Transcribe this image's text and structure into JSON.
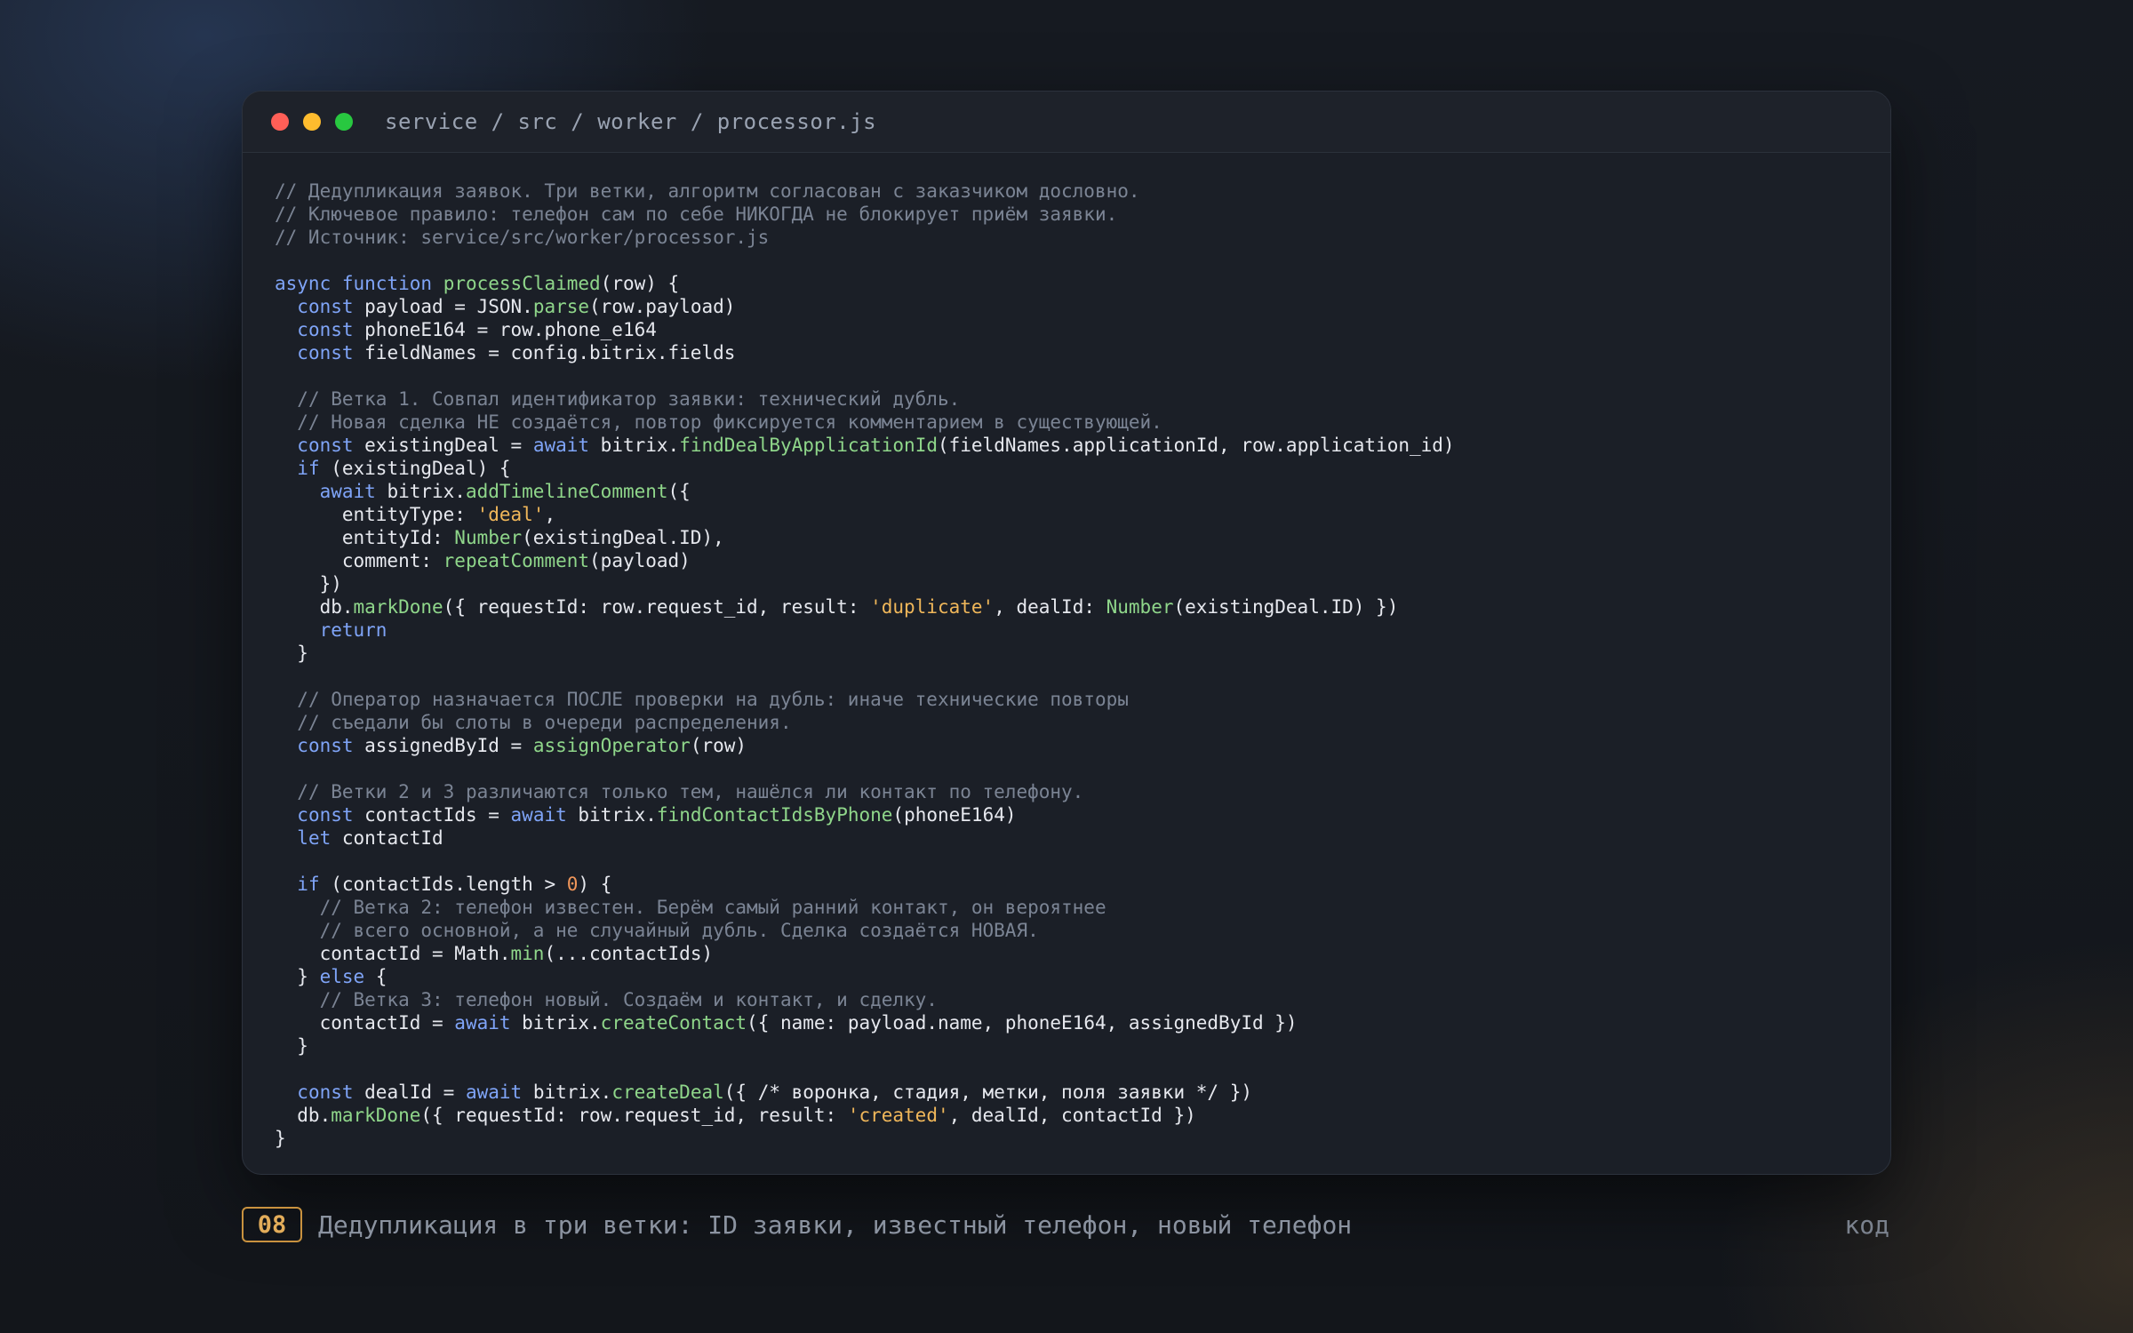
{
  "window": {
    "path": "service / src / worker / processor.js"
  },
  "colors": {
    "comment": "#7b8494",
    "keyword": "#7fa4f7",
    "function": "#8fd68a",
    "string": "#f0b75a",
    "number": "#f0965a",
    "text": "#e6e8ee",
    "badge": "#c9923f"
  },
  "code_lines": [
    [
      {
        "t": "c",
        "v": "// Дедупликация заявок. Три ветки, алгоритм согласован с заказчиком дословно."
      }
    ],
    [
      {
        "t": "c",
        "v": "// Ключевое правило: телефон сам по себе НИКОГДА не блокирует приём заявки."
      }
    ],
    [
      {
        "t": "c",
        "v": "// Источник: service/src/worker/processor.js"
      }
    ],
    [],
    [
      {
        "t": "k",
        "v": "async"
      },
      {
        "t": "p",
        "v": " "
      },
      {
        "t": "k",
        "v": "function"
      },
      {
        "t": "p",
        "v": " "
      },
      {
        "t": "fn",
        "v": "processClaimed"
      },
      {
        "t": "p",
        "v": "(row) {"
      }
    ],
    [
      {
        "t": "p",
        "v": "  "
      },
      {
        "t": "k",
        "v": "const"
      },
      {
        "t": "p",
        "v": " payload = JSON."
      },
      {
        "t": "fn",
        "v": "parse"
      },
      {
        "t": "p",
        "v": "(row.payload)"
      }
    ],
    [
      {
        "t": "p",
        "v": "  "
      },
      {
        "t": "k",
        "v": "const"
      },
      {
        "t": "p",
        "v": " phoneE164 = row.phone_e164"
      }
    ],
    [
      {
        "t": "p",
        "v": "  "
      },
      {
        "t": "k",
        "v": "const"
      },
      {
        "t": "p",
        "v": " fieldNames = config.bitrix.fields"
      }
    ],
    [],
    [
      {
        "t": "p",
        "v": "  "
      },
      {
        "t": "c",
        "v": "// Ветка 1. Совпал идентификатор заявки: технический дубль."
      }
    ],
    [
      {
        "t": "p",
        "v": "  "
      },
      {
        "t": "c",
        "v": "// Новая сделка НЕ создаётся, повтор фиксируется комментарием в существующей."
      }
    ],
    [
      {
        "t": "p",
        "v": "  "
      },
      {
        "t": "k",
        "v": "const"
      },
      {
        "t": "p",
        "v": " existingDeal = "
      },
      {
        "t": "k",
        "v": "await"
      },
      {
        "t": "p",
        "v": " bitrix."
      },
      {
        "t": "fn",
        "v": "findDealByApplicationId"
      },
      {
        "t": "p",
        "v": "(fieldNames.applicationId, row.application_id)"
      }
    ],
    [
      {
        "t": "p",
        "v": "  "
      },
      {
        "t": "k",
        "v": "if"
      },
      {
        "t": "p",
        "v": " (existingDeal) {"
      }
    ],
    [
      {
        "t": "p",
        "v": "    "
      },
      {
        "t": "k",
        "v": "await"
      },
      {
        "t": "p",
        "v": " bitrix."
      },
      {
        "t": "fn",
        "v": "addTimelineComment"
      },
      {
        "t": "p",
        "v": "({"
      }
    ],
    [
      {
        "t": "p",
        "v": "      entityType: "
      },
      {
        "t": "s",
        "v": "'deal'"
      },
      {
        "t": "p",
        "v": ","
      }
    ],
    [
      {
        "t": "p",
        "v": "      entityId: "
      },
      {
        "t": "fn",
        "v": "Number"
      },
      {
        "t": "p",
        "v": "(existingDeal.ID),"
      }
    ],
    [
      {
        "t": "p",
        "v": "      comment: "
      },
      {
        "t": "fn",
        "v": "repeatComment"
      },
      {
        "t": "p",
        "v": "(payload)"
      }
    ],
    [
      {
        "t": "p",
        "v": "    })"
      }
    ],
    [
      {
        "t": "p",
        "v": "    db."
      },
      {
        "t": "fn",
        "v": "markDone"
      },
      {
        "t": "p",
        "v": "({ requestId: row.request_id, result: "
      },
      {
        "t": "s",
        "v": "'duplicate'"
      },
      {
        "t": "p",
        "v": ", dealId: "
      },
      {
        "t": "fn",
        "v": "Number"
      },
      {
        "t": "p",
        "v": "(existingDeal.ID) })"
      }
    ],
    [
      {
        "t": "p",
        "v": "    "
      },
      {
        "t": "k",
        "v": "return"
      }
    ],
    [
      {
        "t": "p",
        "v": "  }"
      }
    ],
    [],
    [
      {
        "t": "p",
        "v": "  "
      },
      {
        "t": "c",
        "v": "// Оператор назначается ПОСЛЕ проверки на дубль: иначе технические повторы"
      }
    ],
    [
      {
        "t": "p",
        "v": "  "
      },
      {
        "t": "c",
        "v": "// съедали бы слоты в очереди распределения."
      }
    ],
    [
      {
        "t": "p",
        "v": "  "
      },
      {
        "t": "k",
        "v": "const"
      },
      {
        "t": "p",
        "v": " assignedById = "
      },
      {
        "t": "fn",
        "v": "assignOperator"
      },
      {
        "t": "p",
        "v": "(row)"
      }
    ],
    [],
    [
      {
        "t": "p",
        "v": "  "
      },
      {
        "t": "c",
        "v": "// Ветки 2 и 3 различаются только тем, нашёлся ли контакт по телефону."
      }
    ],
    [
      {
        "t": "p",
        "v": "  "
      },
      {
        "t": "k",
        "v": "const"
      },
      {
        "t": "p",
        "v": " contactIds = "
      },
      {
        "t": "k",
        "v": "await"
      },
      {
        "t": "p",
        "v": " bitrix."
      },
      {
        "t": "fn",
        "v": "findContactIdsByPhone"
      },
      {
        "t": "p",
        "v": "(phoneE164)"
      }
    ],
    [
      {
        "t": "p",
        "v": "  "
      },
      {
        "t": "k",
        "v": "let"
      },
      {
        "t": "p",
        "v": " contactId"
      }
    ],
    [],
    [
      {
        "t": "p",
        "v": "  "
      },
      {
        "t": "k",
        "v": "if"
      },
      {
        "t": "p",
        "v": " (contactIds.length > "
      },
      {
        "t": "n",
        "v": "0"
      },
      {
        "t": "p",
        "v": ") {"
      }
    ],
    [
      {
        "t": "p",
        "v": "    "
      },
      {
        "t": "c",
        "v": "// Ветка 2: телефон известен. Берём самый ранний контакт, он вероятнее"
      }
    ],
    [
      {
        "t": "p",
        "v": "    "
      },
      {
        "t": "c",
        "v": "// всего основной, а не случайный дубль. Сделка создаётся НОВАЯ."
      }
    ],
    [
      {
        "t": "p",
        "v": "    contactId = Math."
      },
      {
        "t": "fn",
        "v": "min"
      },
      {
        "t": "p",
        "v": "(...contactIds)"
      }
    ],
    [
      {
        "t": "p",
        "v": "  } "
      },
      {
        "t": "k",
        "v": "else"
      },
      {
        "t": "p",
        "v": " {"
      }
    ],
    [
      {
        "t": "p",
        "v": "    "
      },
      {
        "t": "c",
        "v": "// Ветка 3: телефон новый. Создаём и контакт, и сделку."
      }
    ],
    [
      {
        "t": "p",
        "v": "    contactId = "
      },
      {
        "t": "k",
        "v": "await"
      },
      {
        "t": "p",
        "v": " bitrix."
      },
      {
        "t": "fn",
        "v": "createContact"
      },
      {
        "t": "p",
        "v": "({ name: payload.name, phoneE164, assignedById })"
      }
    ],
    [
      {
        "t": "p",
        "v": "  }"
      }
    ],
    [],
    [
      {
        "t": "p",
        "v": "  "
      },
      {
        "t": "k",
        "v": "const"
      },
      {
        "t": "p",
        "v": " dealId = "
      },
      {
        "t": "k",
        "v": "await"
      },
      {
        "t": "p",
        "v": " bitrix."
      },
      {
        "t": "fn",
        "v": "createDeal"
      },
      {
        "t": "p",
        "v": "({ /* воронка, стадия, метки, поля заявки */ })"
      }
    ],
    [
      {
        "t": "p",
        "v": "  db."
      },
      {
        "t": "fn",
        "v": "markDone"
      },
      {
        "t": "p",
        "v": "({ requestId: row.request_id, result: "
      },
      {
        "t": "s",
        "v": "'created'"
      },
      {
        "t": "p",
        "v": ", dealId, contactId })"
      }
    ],
    [
      {
        "t": "p",
        "v": "}"
      }
    ]
  ],
  "caption": {
    "badge": "08",
    "text": "Дедупликация в три ветки: ID заявки, известный телефон, новый телефон",
    "tag": "код"
  }
}
